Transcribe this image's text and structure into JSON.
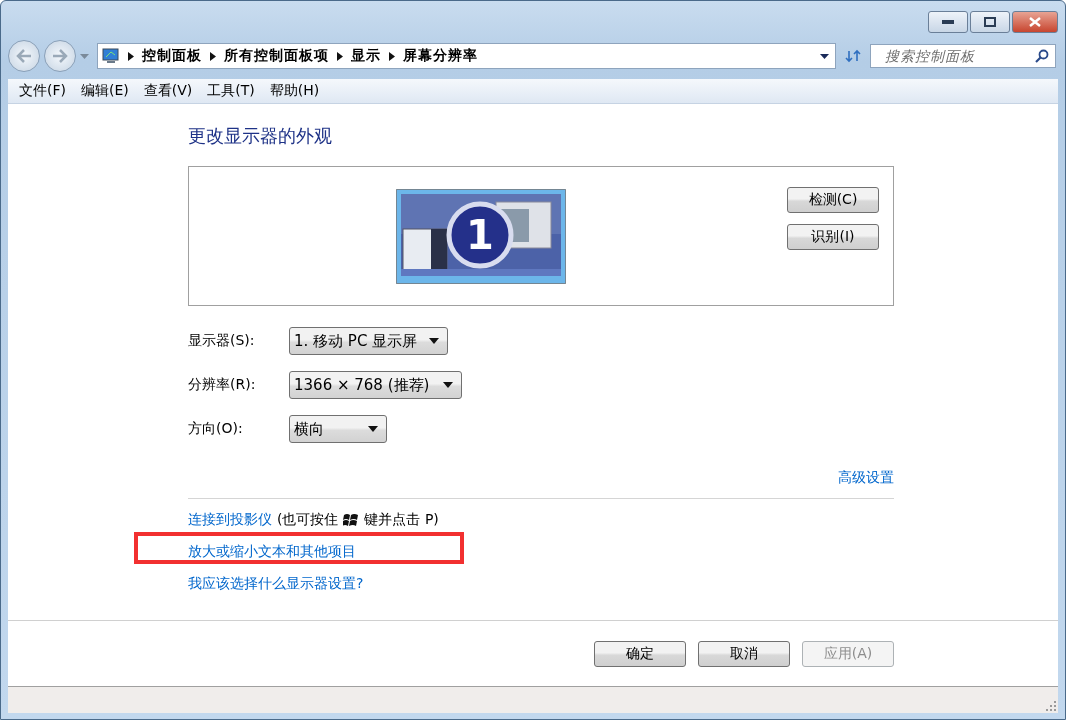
{
  "address_bar": {
    "breadcrumbs": [
      "控制面板",
      "所有控制面板项",
      "显示",
      "屏幕分辨率"
    ]
  },
  "search": {
    "placeholder": "搜索控制面板"
  },
  "menu": [
    "文件(F)",
    "编辑(E)",
    "查看(V)",
    "工具(T)",
    "帮助(H)"
  ],
  "title": "更改显示器的外观",
  "monitor": {
    "number": "1",
    "selected": true
  },
  "side_buttons": [
    "检测(C)",
    "识别(I)"
  ],
  "settings": [
    {
      "label": "显示器(S):",
      "value": "1. 移动 PC 显示屏"
    },
    {
      "label": "分辨率(R):",
      "value": "1366 × 768 (推荐)"
    },
    {
      "label": "方向(O):",
      "value": "横向"
    }
  ],
  "advanced_link": "高级设置",
  "projector": {
    "link": "连接到投影仪",
    "note_before": "(也可按住",
    "note_after": "键并点击 P)"
  },
  "links": [
    {
      "text": "放大或缩小文本和其他项目",
      "highlighted": true
    },
    {
      "text": "我应该选择什么显示器设置?",
      "highlighted": false
    }
  ],
  "buttons": [
    {
      "label": "确定",
      "disabled": false
    },
    {
      "label": "取消",
      "disabled": false
    },
    {
      "label": "应用(A)",
      "disabled": true
    }
  ]
}
